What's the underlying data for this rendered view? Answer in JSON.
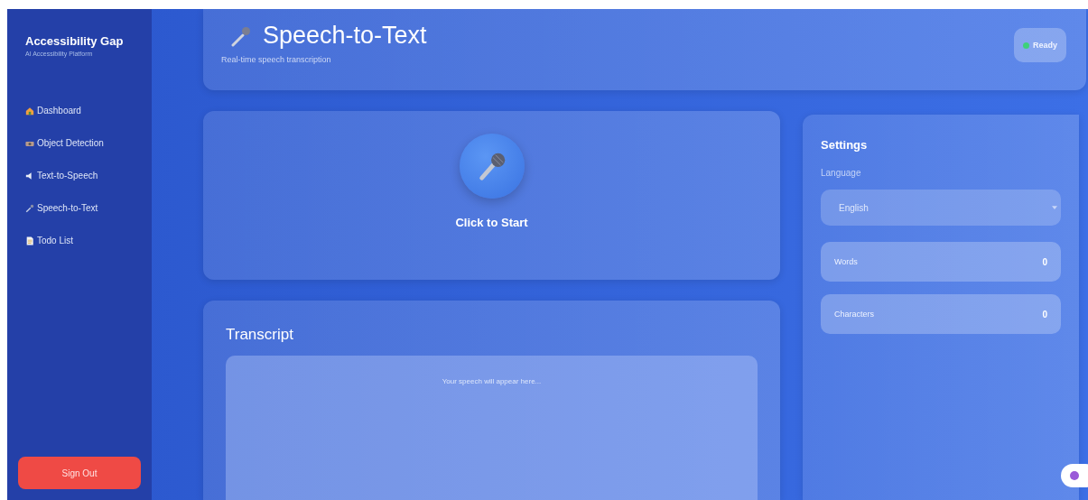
{
  "sidebar": {
    "title": "Accessibility Gap",
    "subtitle": "AI Accessibility Platform",
    "items": [
      {
        "label": "Dashboard",
        "kind": "home",
        "selected": false
      },
      {
        "label": "Object Detection",
        "kind": "camera",
        "selected": false
      },
      {
        "label": "Text-to-Speech",
        "kind": "speaker",
        "selected": false
      },
      {
        "label": "Speech-to-Text",
        "kind": "mic",
        "selected": false
      },
      {
        "label": "Todo List",
        "kind": "doc",
        "selected": false
      }
    ],
    "sign_out": "Sign Out"
  },
  "header": {
    "title": "Speech-to-Text",
    "subtitle": "Real-time speech transcription",
    "status": "Ready"
  },
  "recorder": {
    "label": "Click to Start"
  },
  "transcript": {
    "title": "Transcript",
    "placeholder": "Your speech will appear here..."
  },
  "settings": {
    "title": "Settings",
    "language_label": "Language",
    "language": "English",
    "stats": [
      {
        "label": "Words",
        "value": "0"
      },
      {
        "label": "Characters",
        "value": "0"
      }
    ]
  }
}
